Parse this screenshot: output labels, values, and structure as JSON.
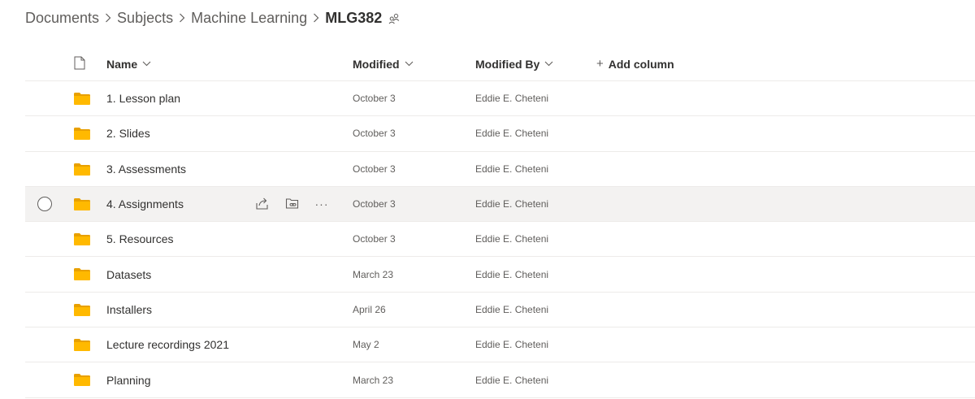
{
  "breadcrumb": {
    "items": [
      "Documents",
      "Subjects",
      "Machine Learning"
    ],
    "current": "MLG382"
  },
  "icons": {
    "separator": "chevron-right-icon",
    "share": "people-share-icon",
    "doc": "document-icon",
    "folder": "folder-icon",
    "row_share": "share-icon",
    "row_copy_link": "copy-link-icon",
    "row_more": "more-icon"
  },
  "colors": {
    "folder": "#ffb900",
    "folder_back": "#e8a000",
    "hover_row": "#f3f2f1",
    "text_primary": "#323130",
    "text_secondary": "#605e5c"
  },
  "columns": {
    "name": "Name",
    "modified": "Modified",
    "modified_by": "Modified By",
    "add_column": "Add column",
    "add_plus": "+"
  },
  "row_actions": {
    "more": "···"
  },
  "rows": [
    {
      "name": "1. Lesson plan",
      "modified": "October 3",
      "modified_by": "Eddie E. Cheteni"
    },
    {
      "name": "2. Slides",
      "modified": "October 3",
      "modified_by": "Eddie E. Cheteni"
    },
    {
      "name": "3. Assessments",
      "modified": "October 3",
      "modified_by": "Eddie E. Cheteni"
    },
    {
      "name": "4. Assignments",
      "modified": "October 3",
      "modified_by": "Eddie E. Cheteni",
      "hovered": true
    },
    {
      "name": "5. Resources",
      "modified": "October 3",
      "modified_by": "Eddie E. Cheteni"
    },
    {
      "name": "Datasets",
      "modified": "March 23",
      "modified_by": "Eddie E. Cheteni"
    },
    {
      "name": "Installers",
      "modified": "April 26",
      "modified_by": "Eddie E. Cheteni"
    },
    {
      "name": "Lecture recordings 2021",
      "modified": "May 2",
      "modified_by": "Eddie E. Cheteni"
    },
    {
      "name": "Planning",
      "modified": "March 23",
      "modified_by": "Eddie E. Cheteni"
    }
  ]
}
